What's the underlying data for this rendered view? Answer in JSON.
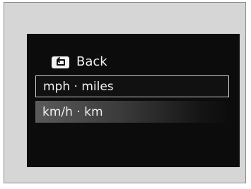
{
  "menu": {
    "back_label": "Back",
    "items": [
      {
        "label": "mph · miles",
        "selected": true
      },
      {
        "label": "km/h · km",
        "selected": false
      }
    ]
  },
  "icons": {
    "back": "back-arrow-icon"
  },
  "colors": {
    "screen_background": "#0c0c0c",
    "text": "#f0f0f0",
    "panel": "#d6d6d6"
  }
}
